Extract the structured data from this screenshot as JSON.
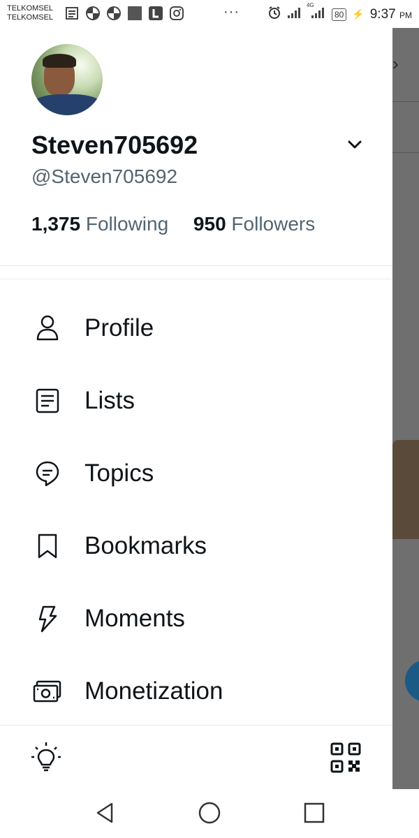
{
  "status_bar": {
    "carrier_1": "TELKOMSEL",
    "carrier_2": "TELKOMSEL",
    "overflow": "···",
    "network": "4G",
    "battery": "80",
    "time": "9:37",
    "time_suffix": "PM",
    "icons": [
      "news-icon",
      "pinwheel-icon",
      "pinwheel-icon",
      "square-app-icon",
      "l-app-icon",
      "instagram-icon",
      "alarm-icon",
      "signal-icon",
      "signal-icon",
      "battery-icon",
      "charging-icon"
    ]
  },
  "profile": {
    "name": "Steven705692",
    "handle": "@Steven705692",
    "following_count": "1,375",
    "following_label": "Following",
    "followers_count": "950",
    "followers_label": "Followers"
  },
  "menu": {
    "items": [
      {
        "label": "Profile",
        "icon": "person-icon"
      },
      {
        "label": "Lists",
        "icon": "list-icon"
      },
      {
        "label": "Topics",
        "icon": "topic-bubble-icon"
      },
      {
        "label": "Bookmarks",
        "icon": "bookmark-icon"
      },
      {
        "label": "Moments",
        "icon": "lightning-icon"
      },
      {
        "label": "Monetization",
        "icon": "money-icon"
      }
    ]
  },
  "footer": {
    "left_icon": "lightbulb-icon",
    "right_icon": "qr-code-icon"
  },
  "nav": {
    "icons": [
      "back-icon",
      "home-icon",
      "recents-icon"
    ]
  },
  "colors": {
    "text_primary": "#0f1419",
    "text_secondary": "#536471",
    "divider": "#e6ebef",
    "overlay": "#6f6f6f"
  }
}
